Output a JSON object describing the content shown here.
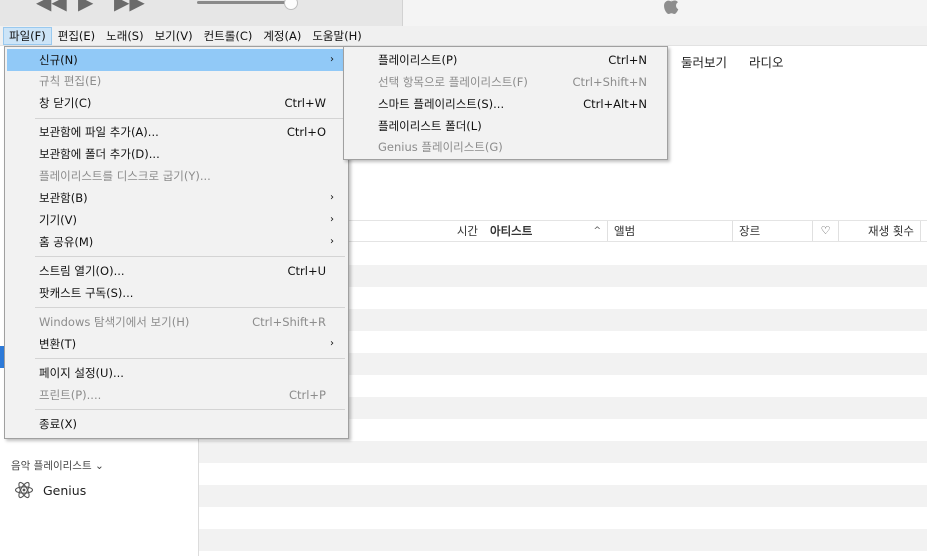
{
  "player": {
    "rewind_icon": "rewind-icon",
    "play_icon": "play-icon",
    "forward_icon": "fast-forward-icon",
    "volume_level": 0.92,
    "logo_icon": "apple-logo-icon"
  },
  "menubar": {
    "items": [
      {
        "label": "파일(F)",
        "active": true
      },
      {
        "label": "편집(E)"
      },
      {
        "label": "노래(S)"
      },
      {
        "label": "보기(V)"
      },
      {
        "label": "컨트롤(C)"
      },
      {
        "label": "계정(A)"
      },
      {
        "label": "도움말(H)"
      }
    ]
  },
  "tabs": [
    "둘러보기",
    "라디오"
  ],
  "columns": [
    {
      "label": "시간"
    },
    {
      "label": "아티스트",
      "sorted": "ascending"
    },
    {
      "label": "앨범"
    },
    {
      "label": "장르"
    },
    {
      "label": "",
      "icon": "heart-icon"
    },
    {
      "label": "재생 횟수"
    }
  ],
  "sidebar": {
    "section_label": "음악 플레이리스트 ⌄",
    "genius_label": "Genius",
    "genius_icon": "genius-atom-icon"
  },
  "file_menu": {
    "items": [
      {
        "label": "신규(N)",
        "submenu": true,
        "highlighted": true
      },
      {
        "label": "규칙 편집(E)",
        "disabled": true
      },
      {
        "label": "창 닫기(C)",
        "shortcut": "Ctrl+W"
      },
      {
        "label": "보관함에 파일 추가(A)...",
        "shortcut": "Ctrl+O"
      },
      {
        "label": "보관함에 폴더 추가(D)..."
      },
      {
        "label": "플레이리스트를 디스크로 굽기(Y)...",
        "disabled": true
      },
      {
        "label": "보관함(B)",
        "submenu": true
      },
      {
        "label": "기기(V)",
        "submenu": true
      },
      {
        "label": "홈 공유(M)",
        "submenu": true
      },
      {
        "label": "스트림 열기(O)...",
        "shortcut": "Ctrl+U"
      },
      {
        "label": "팟캐스트 구독(S)..."
      },
      {
        "label": "Windows 탐색기에서 보기(H)",
        "shortcut": "Ctrl+Shift+R",
        "disabled": true
      },
      {
        "label": "변환(T)",
        "submenu": true
      },
      {
        "label": "페이지 설정(U)..."
      },
      {
        "label": "프린트(P)....",
        "shortcut": "Ctrl+P",
        "disabled": true
      },
      {
        "label": "종료(X)"
      }
    ]
  },
  "new_submenu": {
    "items": [
      {
        "label": "플레이리스트(P)",
        "shortcut": "Ctrl+N"
      },
      {
        "label": "선택 항목으로 플레이리스트(F)",
        "shortcut": "Ctrl+Shift+N",
        "disabled": true
      },
      {
        "label": "스마트 플레이리스트(S)...",
        "shortcut": "Ctrl+Alt+N"
      },
      {
        "label": "플레이리스트 폴더(L)"
      },
      {
        "label": "Genius 플레이리스트(G)",
        "disabled": true
      }
    ]
  },
  "arrow_glyph": "›",
  "colors": {
    "menu_highlight": "#91c9f7",
    "menubar_active": "#cce4f7",
    "selection_accent": "#2d7ad9",
    "row_alt": "#f2f2f2"
  }
}
